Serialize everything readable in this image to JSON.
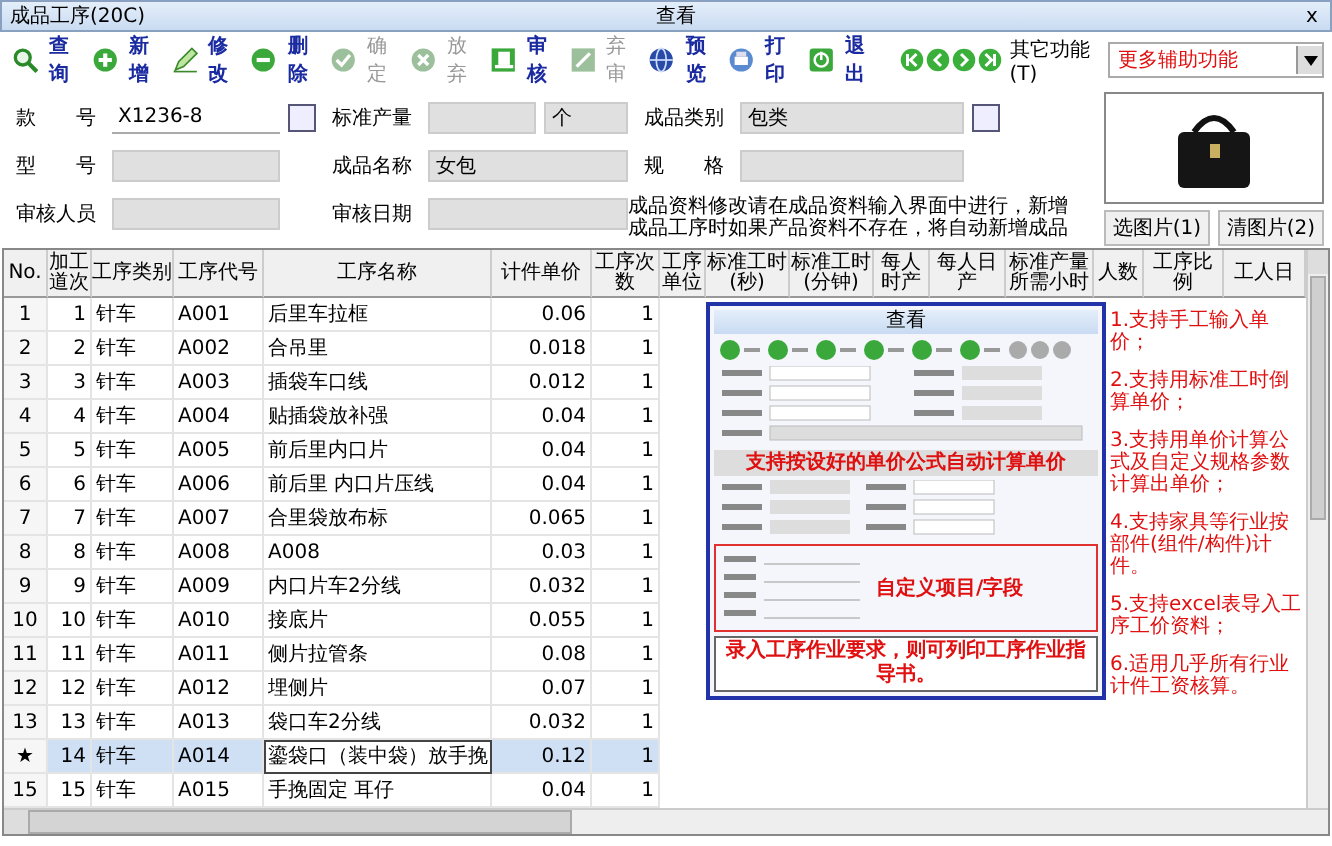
{
  "window": {
    "title": "成品工序(20C)",
    "mode": "查看",
    "close": "x"
  },
  "toolbar": {
    "items": [
      {
        "label": "查询",
        "disabled": false
      },
      {
        "label": "新增",
        "disabled": false
      },
      {
        "label": "修改",
        "disabled": false
      },
      {
        "label": "删除",
        "disabled": false
      },
      {
        "label": "确定",
        "disabled": true
      },
      {
        "label": "放弃",
        "disabled": true
      },
      {
        "label": "审核",
        "disabled": false
      },
      {
        "label": "弃审",
        "disabled": true
      },
      {
        "label": "预览",
        "disabled": false
      },
      {
        "label": "打印",
        "disabled": false
      },
      {
        "label": "退出",
        "disabled": false
      }
    ],
    "other_label": "其它功能(T)",
    "other_value": "更多辅助功能"
  },
  "form": {
    "columns": [
      [
        {
          "label": "款　　号",
          "value": "X1236-8",
          "editable": true,
          "lookup": true
        },
        {
          "label": "型　　号",
          "editable": false,
          "lookup": false
        },
        {
          "label": "审核人员",
          "editable": false,
          "lookup": false
        }
      ],
      [
        {
          "label": "标准产量",
          "unit": "个",
          "editable": false,
          "lookup": false
        },
        {
          "label": "成品名称",
          "value": "女包",
          "editable": false,
          "lookup": false
        },
        {
          "label": "审核日期",
          "editable": false,
          "lookup": false
        }
      ],
      [
        {
          "label": "成品类别",
          "value": "包类",
          "editable": false,
          "lookup": true
        },
        {
          "label": "规　　格",
          "editable": false,
          "lookup": false
        }
      ]
    ],
    "note": "成品资料修改请在成品资料输入界面中进行，新增成品工序时如果产品资料不存在，将自动新增成品",
    "photo_buttons": [
      "选图片(1)",
      "清图片(2)"
    ]
  },
  "table": {
    "columns": [
      "No.",
      "加工道次",
      "工序类别",
      "工序代号",
      "工序名称",
      "计件单价",
      "工序次数",
      "工序单位",
      "标准工时(秒)",
      "标准工时(分钟)",
      "每人时产",
      "每人日产",
      "标准产量所需小时",
      "人数",
      "工序比例",
      "工人日"
    ],
    "rows": [
      {
        "no": "1",
        "seq": "1",
        "category": "针车",
        "code": "A001",
        "name": "后里车拉框",
        "price": "0.06",
        "count": "1",
        "selected": false,
        "editing": false
      },
      {
        "no": "2",
        "seq": "2",
        "category": "针车",
        "code": "A002",
        "name": "合吊里",
        "price": "0.018",
        "count": "1",
        "selected": false,
        "editing": false
      },
      {
        "no": "3",
        "seq": "3",
        "category": "针车",
        "code": "A003",
        "name": "插袋车口线",
        "price": "0.012",
        "count": "1",
        "selected": false,
        "editing": false
      },
      {
        "no": "4",
        "seq": "4",
        "category": "针车",
        "code": "A004",
        "name": "贴插袋放补强",
        "price": "0.04",
        "count": "1",
        "selected": false,
        "editing": false
      },
      {
        "no": "5",
        "seq": "5",
        "category": "针车",
        "code": "A005",
        "name": "前后里内口片",
        "price": "0.04",
        "count": "1",
        "selected": false,
        "editing": false
      },
      {
        "no": "6",
        "seq": "6",
        "category": "针车",
        "code": "A006",
        "name": "前后里 内口片压线",
        "price": "0.04",
        "count": "1",
        "selected": false,
        "editing": false
      },
      {
        "no": "7",
        "seq": "7",
        "category": "针车",
        "code": "A007",
        "name": "合里袋放布标",
        "price": "0.065",
        "count": "1",
        "selected": false,
        "editing": false
      },
      {
        "no": "8",
        "seq": "8",
        "category": "针车",
        "code": "A008",
        "name": "A008",
        "price": "0.03",
        "count": "1",
        "selected": false,
        "editing": false
      },
      {
        "no": "9",
        "seq": "9",
        "category": "针车",
        "code": "A009",
        "name": "内口片车2分线",
        "price": "0.032",
        "count": "1",
        "selected": false,
        "editing": false
      },
      {
        "no": "10",
        "seq": "10",
        "category": "针车",
        "code": "A010",
        "name": "接底片",
        "price": "0.055",
        "count": "1",
        "selected": false,
        "editing": false
      },
      {
        "no": "11",
        "seq": "11",
        "category": "针车",
        "code": "A011",
        "name": "侧片拉管条",
        "price": "0.08",
        "count": "1",
        "selected": false,
        "editing": false
      },
      {
        "no": "12",
        "seq": "12",
        "category": "针车",
        "code": "A012",
        "name": "埋侧片",
        "price": "0.07",
        "count": "1",
        "selected": false,
        "editing": false
      },
      {
        "no": "13",
        "seq": "13",
        "category": "针车",
        "code": "A013",
        "name": "袋口车2分线",
        "price": "0.032",
        "count": "1",
        "selected": false,
        "editing": false
      },
      {
        "no": "★",
        "seq": "14",
        "category": "针车",
        "code": "A014",
        "name": "鎏袋口（装中袋）放手挽",
        "price": "0.12",
        "count": "1",
        "selected": true,
        "editing": true
      },
      {
        "no": "15",
        "seq": "15",
        "category": "针车",
        "code": "A015",
        "name": "手挽固定 耳仔",
        "price": "0.04",
        "count": "1",
        "selected": false,
        "editing": false
      }
    ]
  },
  "inset": {
    "title": "查看",
    "formula_hint": "支持按设好的单价公式自动计算单价",
    "custom_hint": "自定义项目/字段",
    "print_hint": "录入工序作业要求，则可列印工序作业指导书。"
  },
  "notes": [
    "1.支持手工输入单价；",
    "2.支持用标准工时倒算单价；",
    "3.支持用单价计算公式及自定义规格参数计算出单价；",
    "4.支持家具等行业按部件(组件/构件)计件。",
    "5.支持excel表导入工序工价资料；",
    "6.适用几乎所有行业计件工资核算。"
  ]
}
